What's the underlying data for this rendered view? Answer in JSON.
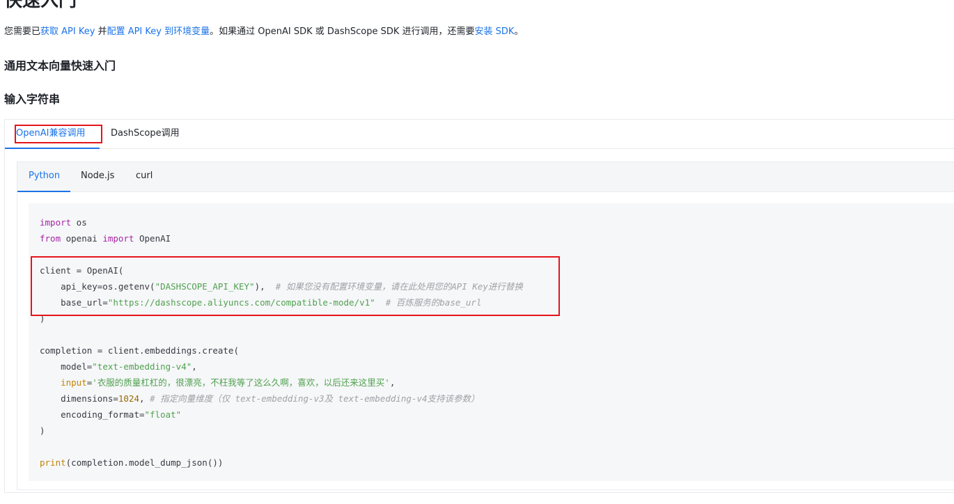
{
  "page": {
    "title": "快速入门",
    "intro": {
      "t1": "您需要已",
      "link1": "获取 API Key",
      "t2": " 并",
      "link2": "配置 API Key 到环境变量",
      "t3": "。如果通过 OpenAI SDK 或 DashScope SDK 进行调用，还需要",
      "link3": "安装 SDK",
      "t4": "。"
    },
    "section_title": "通用文本向量快速入门",
    "subsection_title": "输入字符串"
  },
  "outer_tabs": [
    {
      "label": "OpenAI兼容调用",
      "active": true
    },
    {
      "label": "DashScope调用",
      "active": false
    }
  ],
  "inner_tabs": [
    {
      "label": "Python",
      "active": true
    },
    {
      "label": "Node.js",
      "active": false
    },
    {
      "label": "curl",
      "active": false
    }
  ],
  "code": {
    "l1_kw": "import",
    "l1_rest": " os",
    "l2_kw1": "from",
    "l2_mid": " openai ",
    "l2_kw2": "import",
    "l2_rest": " OpenAI",
    "l4": "client = OpenAI(",
    "l5_pre": "    api_key=os.getenv(",
    "l5_str": "\"DASHSCOPE_API_KEY\"",
    "l5_post": "),  ",
    "l5_cmt": "# 如果您没有配置环境变量，请在此处用您的API Key进行替换",
    "l6_pre": "    base_url=",
    "l6_str": "\"https://dashscope.aliyuncs.com/compatible-mode/v1\"",
    "l6_sp": "  ",
    "l6_cmt": "# 百炼服务的base_url",
    "l7": ")",
    "l9": "completion = client.embeddings.create(",
    "l10_pre": "    model=",
    "l10_str": "\"text-embedding-v4\"",
    "l10_post": ",",
    "l11_ind": "    ",
    "l11_fn": "input",
    "l11_eq": "=",
    "l11_str": "'衣服的质量杠杠的，很漂亮，不枉我等了这么久啊，喜欢，以后还来这里买'",
    "l11_post": ",",
    "l12_pre": "    dimensions=",
    "l12_num": "1024",
    "l12_post": ", ",
    "l12_cmt": "# 指定向量维度（仅 text-embedding-v3及 text-embedding-v4支持该参数）",
    "l13_pre": "    encoding_format=",
    "l13_str": "\"float\"",
    "l14": ")",
    "l16_fn": "print",
    "l16_rest": "(completion.model_dump_json())"
  },
  "colors": {
    "link": "#1a73e8",
    "highlight_box": "#e5141b",
    "keyword": "#a626a4",
    "string": "#50a14f",
    "comment": "#a0a1a7",
    "number": "#986801",
    "builtin": "#c18401"
  }
}
